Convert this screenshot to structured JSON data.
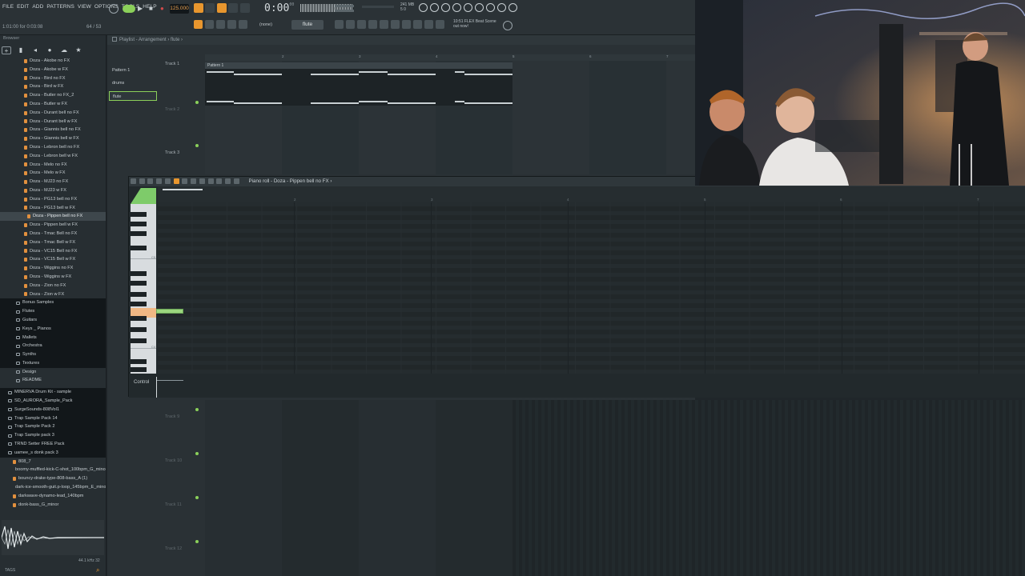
{
  "menu": [
    "FILE",
    "EDIT",
    "ADD",
    "PATTERNS",
    "VIEW",
    "OPTIONS",
    "TOOLS",
    "HELP"
  ],
  "toolbar": {
    "tempo": "125.000",
    "time": "0:00",
    "time_sub": "00",
    "pattern_name": "flute",
    "snap_mode": "(none)",
    "hint_left": "1:01:00 for 0:03:08",
    "hint_right": "64 / 53",
    "cpu": [
      "241 MB",
      "5 0"
    ],
    "news": [
      "10:51 FLEX Beat Scene",
      "out now!"
    ]
  },
  "browser": {
    "title": "Browser",
    "items": [
      "Doza - Akobe no FX",
      "Doza - Akobe w FX",
      "Doza - Bird no FX",
      "Doza - Bird w FX",
      "Doza - Butler no FX_2",
      "Doza - Butler w FX",
      "Doza - Durant bell no FX",
      "Doza - Durant bell w FX",
      "Doza - Giannis bell no FX",
      "Doza - Giannis bell w FX",
      "Doza - Lebron bell no FX",
      "Doza - Lebron bell w FX",
      "Doza - Melo no FX",
      "Doza - Melo w FX",
      "Doza - MJ23 no FX",
      "Doza - MJ23 w FX",
      "Doza - PG13 bell no FX",
      "Doza - PG13 bell w FX"
    ],
    "selected": "Doza - Pippen bell no FX",
    "items2": [
      "Doza - Pippen bell w FX",
      "Doza - Tmac Bell no FX",
      "Doza - Tmac Bell w FX",
      "Doza - VC15 Bell no FX",
      "Doza - VC15 Bell w FX",
      "Doza - Wiggins no FX",
      "Doza - Wiggins w FX",
      "Doza - Zion no FX",
      "Doza - Zion w FX"
    ],
    "folders": [
      "Bonus Samples",
      "Flutes",
      "Guitars",
      "Keys _ Pianos",
      "Mallets",
      "Orchestra",
      "Synths",
      "Textures"
    ],
    "misc": [
      "Design",
      "README"
    ],
    "packs": [
      "MINERVA Drum Kit - sample",
      "SD_AURORA_Sample_Pack",
      "SurgeSounds-808Vol1",
      "Trap Sample Pack 14",
      "Trap Sample Pack 2",
      "Trap Sample pack 3",
      "TRND Setter FREE Pack",
      "uamee_s donk pack 3"
    ],
    "files": [
      "808_7",
      "boomy-muffled-kick-C-shot_100bpm_G_minor",
      "bouncy-drake-type-808-bass_A (1)",
      "dark-ice-smooth-guit.p-loop_145bpm_E_minor",
      "darkwave-dynamo-lead_140bpm",
      "donk-bass_G_minor"
    ],
    "footer_left": "TAGS",
    "footer_right": "44.1 kHz 32"
  },
  "playlist": {
    "title": "Playlist - Arrangement › flute ›",
    "patterns": [
      "Pattern 1",
      "drums",
      "flute"
    ],
    "tracks": [
      "Track 1",
      "Track 2",
      "Track 3"
    ],
    "clip_label": "Pattern 1",
    "flute_clip_label": "flute",
    "ruler": [
      "2",
      "3",
      "4",
      "5",
      "6",
      "7"
    ],
    "bottom_tracks": [
      "Track 9",
      "Track 10",
      "Track 11",
      "Track 12"
    ]
  },
  "piano_roll": {
    "title": "Piano roll - Doza - Pippen bell no FX ›",
    "ruler": [
      "2",
      "3",
      "4",
      "5",
      "6",
      "7"
    ],
    "key_labels": [
      "C5",
      "C4"
    ],
    "control_label": "Control"
  }
}
